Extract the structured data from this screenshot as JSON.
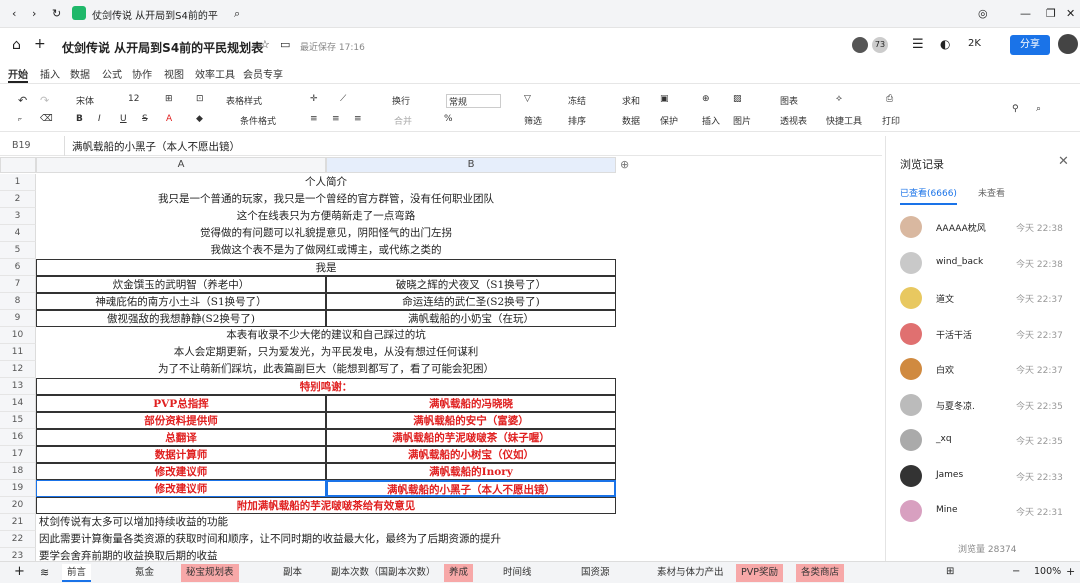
{
  "browser": {
    "tab_title": "仗剑传说 从开局到S4前的平",
    "search_icon": "search-icon"
  },
  "header": {
    "title": "仗剑传说 从开局到S4前的平民规划表",
    "save_status": "最近保存 17:16",
    "share": "分享",
    "count": "2K",
    "avatar_count": "73"
  },
  "menu": [
    "开始",
    "插入",
    "数据",
    "公式",
    "协作",
    "视图",
    "效率工具",
    "会员专享"
  ],
  "toolbar": {
    "font": "宋体",
    "size": "12",
    "table_style": "表格样式",
    "wrap": "换行",
    "number_format": "常规",
    "freeze": "冻结",
    "sum": "求和",
    "chart": "图表",
    "quick_tools": "快捷工具",
    "merge": "合并",
    "cond_format": "条件格式",
    "filter": "筛选",
    "sort": "排序",
    "data": "数据",
    "protect": "保护",
    "insert": "插入",
    "picture": "图片",
    "pivot": "透视表",
    "print": "打印"
  },
  "formula": {
    "cell": "B19",
    "value": "满帆载船的小黑子（本人不愿出镜）"
  },
  "columns": [
    "A",
    "B"
  ],
  "rows": [
    {
      "n": "1",
      "t": "merge",
      "a": "个人简介"
    },
    {
      "n": "2",
      "t": "merge",
      "a": "我只是一个普通的玩家，我只是一个曾经的官方群管，没有任何职业团队"
    },
    {
      "n": "3",
      "t": "merge",
      "a": "这个在线表只为方便萌新走了一点弯路"
    },
    {
      "n": "4",
      "t": "merge",
      "a": "觉得做的有问题可以礼貌提意见，阴阳怪气的出门左拐"
    },
    {
      "n": "5",
      "t": "merge",
      "a": "我做这个表不是为了做网红或博主，或代练之类的"
    },
    {
      "n": "6",
      "t": "mergebox",
      "a": "我是"
    },
    {
      "n": "7",
      "t": "split",
      "a": "炊金馔玉的武明智（养老中）",
      "b": "破晓之辉的犬夜叉（S1换号了）"
    },
    {
      "n": "8",
      "t": "split",
      "a": "神魂庇佑的南方小土斗（S1换号了）",
      "b": "命运连结的武仁圣(S2换号了)"
    },
    {
      "n": "9",
      "t": "split",
      "a": "傲视强敌的我想静静(S2换号了)",
      "b": "满帆载船的小奶宝（在玩）"
    },
    {
      "n": "10",
      "t": "merge",
      "a": "本表有收录不少大佬的建议和自己踩过的坑"
    },
    {
      "n": "11",
      "t": "merge",
      "a": "本人会定期更新，只为爱发光，为平民发电，从没有想过任何谋利"
    },
    {
      "n": "12",
      "t": "merge",
      "a": "为了不让萌新们踩坑，此表篇副巨大（能想到都写了，看了可能会犯困）"
    },
    {
      "n": "13",
      "t": "mergered",
      "a": "特别鸣谢："
    },
    {
      "n": "14",
      "t": "splitred",
      "a": "PVP总指挥",
      "b": "满帆载船的冯晓晓"
    },
    {
      "n": "15",
      "t": "splitred",
      "a": "部份资料提供师",
      "b": "满帆载船的安宁（富婆）"
    },
    {
      "n": "16",
      "t": "splitred",
      "a": "总翻译",
      "b": "满帆载船的芋泥啵啵茶（妹子喔）"
    },
    {
      "n": "17",
      "t": "splitred",
      "a": "数据计算师",
      "b": "满帆载船的小树宝（仪如）"
    },
    {
      "n": "18",
      "t": "splitred",
      "a": "修改建议师",
      "b": "满帆载船的Inory"
    },
    {
      "n": "19",
      "t": "splitred",
      "a": "修改建议师",
      "b": "满帆载船的小黑子（本人不愿出镜）"
    },
    {
      "n": "20",
      "t": "mergered",
      "a": "附加满帆载船的芋泥啵啵茶给有效意见"
    },
    {
      "n": "21",
      "t": "leftfree",
      "a": "杖剑传说有太多可以增加持续收益的功能"
    },
    {
      "n": "22",
      "t": "leftfree",
      "a": "因此需要计算衡量各类资源的获取时间和顺序，让不同时期的收益最大化，最终为了后期资源的提升"
    },
    {
      "n": "23",
      "t": "leftfree",
      "a": "要学会舍弃前期的收益换取后期的收益"
    }
  ],
  "sidebar": {
    "title": "浏览记录",
    "tab_viewed": "已查看(6666)",
    "tab_unviewed": "未查看",
    "views": "浏览量 28374",
    "items": [
      {
        "name": "AAAAA枕风",
        "time": "今天 22:38",
        "color": "#d9b8a0"
      },
      {
        "name": "wind_back",
        "time": "今天 22:38",
        "color": "#c9c9c9"
      },
      {
        "name": "道文",
        "time": "今天 22:37",
        "color": "#e8c860"
      },
      {
        "name": "干活干活",
        "time": "今天 22:37",
        "color": "#e07070"
      },
      {
        "name": "白欢",
        "time": "今天 22:37",
        "color": "#d08a40"
      },
      {
        "name": "与夏冬凉.",
        "time": "今天 22:35",
        "color": "#bbbbbb"
      },
      {
        "name": "_xq",
        "time": "今天 22:35",
        "color": "#aaaaaa"
      },
      {
        "name": "James",
        "time": "今天 22:33",
        "color": "#333333"
      },
      {
        "name": "Mine",
        "time": "今天 22:31",
        "color": "#d8a0c0"
      }
    ]
  },
  "sheets": [
    {
      "label": "前言",
      "pink": false,
      "active": true
    },
    {
      "label": "氪金",
      "pink": false
    },
    {
      "label": "秘宝规划表",
      "pink": true
    },
    {
      "label": "副本",
      "pink": false
    },
    {
      "label": "副本次数（国副本次数）",
      "pink": false
    },
    {
      "label": "养成",
      "pink": true
    },
    {
      "label": "时间线",
      "pink": false
    },
    {
      "label": "国资源",
      "pink": false
    },
    {
      "label": "素材与体力产出",
      "pink": false
    },
    {
      "label": "PVP奖励",
      "pink": true
    },
    {
      "label": "各类商店",
      "pink": true
    }
  ],
  "zoom": "100%"
}
